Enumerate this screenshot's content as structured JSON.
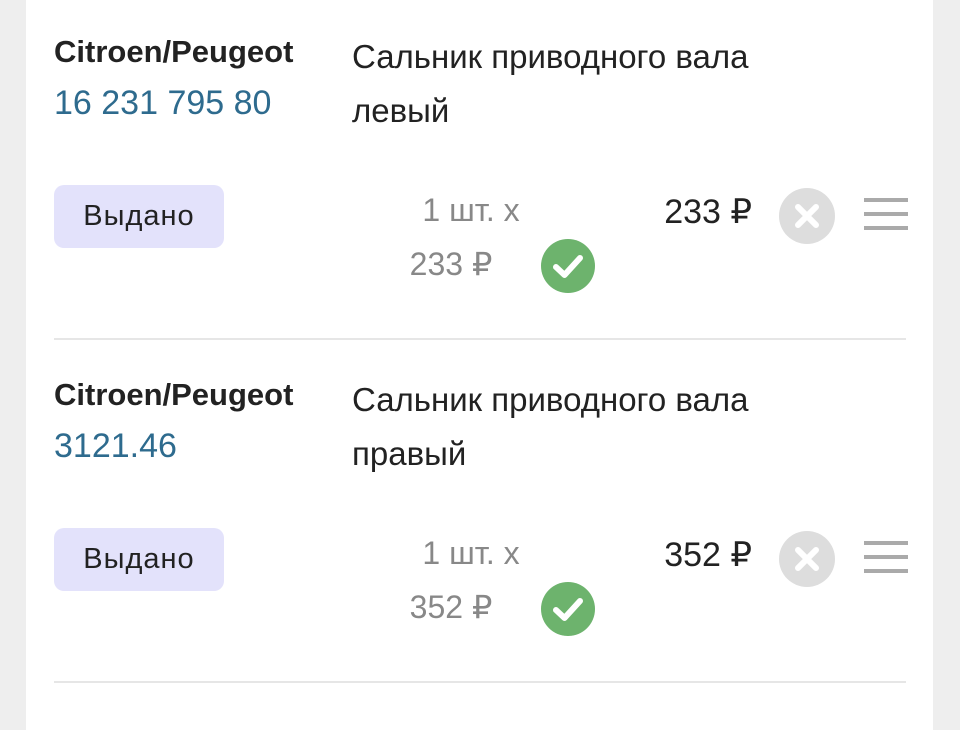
{
  "items": [
    {
      "brand": "Citroen/Peugeot",
      "code": "16 231 795 80",
      "description": "Сальник приводного вала левый",
      "status": "Выдано",
      "quantity": "1 шт. х",
      "unit_price": "233 ₽",
      "total": "233 ₽"
    },
    {
      "brand": "Citroen/Peugeot",
      "code": "3121.46",
      "description": "Сальник приводного вала правый",
      "status": "Выдано",
      "quantity": "1 шт. х",
      "unit_price": "352 ₽",
      "total": "352 ₽"
    }
  ],
  "colors": {
    "code": "#2e6b8e",
    "status_bg": "#e3e2fb",
    "check": "#6db36d",
    "remove": "#dddddd",
    "menu": "#aaaaaa"
  },
  "icons": {
    "confirm": "check-circle-icon",
    "remove": "close-circle-icon",
    "menu": "hamburger-menu-icon"
  }
}
